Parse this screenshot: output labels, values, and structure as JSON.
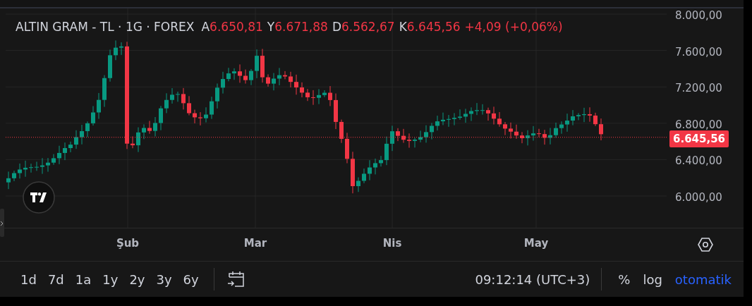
{
  "header": {
    "title": "ALTIN GRAM - TL · 1G · FOREX",
    "ohlc": [
      {
        "label": "A",
        "value": "6.650,81"
      },
      {
        "label": "Y",
        "value": "6.671,88"
      },
      {
        "label": "D",
        "value": "6.562,67"
      },
      {
        "label": "K",
        "value": "6.645,56"
      }
    ],
    "change": "+4,09 (+0,06%)"
  },
  "price_axis": {
    "labels": [
      "8.000,00",
      "7.600,00",
      "7.200,00",
      "6.800,00",
      "6.400,00",
      "6.000,00"
    ],
    "last_price": "6.645,56"
  },
  "time_axis": {
    "labels": [
      "Şub",
      "Mar",
      "Nis",
      "May"
    ]
  },
  "toolbar": {
    "ranges": [
      "1d",
      "7d",
      "1a",
      "1y",
      "2y",
      "3y",
      "6y"
    ],
    "clock": "09:12:14 (UTC+3)",
    "scale_options": [
      {
        "label": "%",
        "selected": false
      },
      {
        "label": "log",
        "selected": false
      },
      {
        "label": "otomatik",
        "selected": true
      }
    ]
  }
}
